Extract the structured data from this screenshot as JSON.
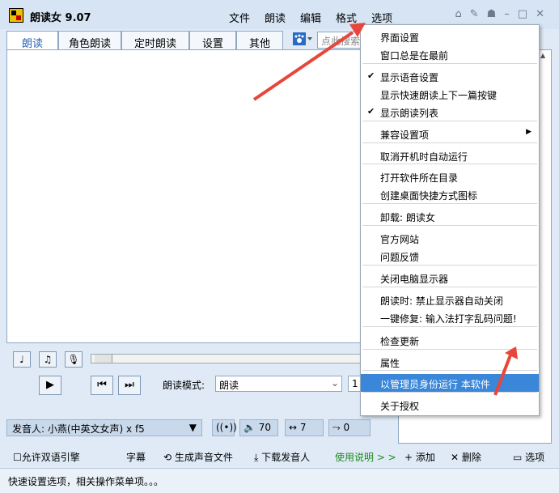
{
  "app": {
    "title": "朗读女 9.07"
  },
  "menubar": [
    "文件",
    "朗读",
    "编辑",
    "格式",
    "选项"
  ],
  "tabs": [
    "朗读",
    "角色朗读",
    "定时朗读",
    "设置",
    "其他"
  ],
  "search": {
    "placeholder": "点此搜索"
  },
  "controls": {
    "mode_label": "朗读模式:",
    "mode_value": "朗读",
    "small_value": "1"
  },
  "voice": {
    "speaker": "发音人: 小燕(中英文女声) x f5",
    "volume": "70",
    "speed": "7",
    "pitch": "0"
  },
  "bottom": {
    "bilingual": "允许双语引擎",
    "subtitles": "字幕",
    "generate_audio": "生成声音文件",
    "download_voice": "下载发音人",
    "help": "使用说明 > >",
    "add": "添加",
    "delete": "删除",
    "options": "选项"
  },
  "status": "快速设置选项，相关操作菜单项。。。",
  "dropdown": {
    "items": [
      {
        "label": "界面设置",
        "checked": false,
        "submenu": false
      },
      {
        "label": "窗口总是在最前",
        "checked": false,
        "submenu": false
      },
      {
        "label": "显示语音设置",
        "checked": true,
        "submenu": false
      },
      {
        "label": "显示快速朗读上下一篇按键",
        "checked": false,
        "submenu": false
      },
      {
        "label": "显示朗读列表",
        "checked": true,
        "submenu": false
      },
      {
        "label": "兼容设置项",
        "checked": false,
        "submenu": true
      },
      {
        "label": "取消开机时自动运行",
        "checked": false,
        "submenu": false
      },
      {
        "label": "打开软件所在目录",
        "checked": false,
        "submenu": false
      },
      {
        "label": "创建桌面快捷方式图标",
        "checked": false,
        "submenu": false
      },
      {
        "label": "卸载: 朗读女",
        "checked": false,
        "submenu": false
      },
      {
        "label": "官方网站",
        "checked": false,
        "submenu": false
      },
      {
        "label": "问题反馈",
        "checked": false,
        "submenu": false
      },
      {
        "label": "关闭电脑显示器",
        "checked": false,
        "submenu": false
      },
      {
        "label": "朗读时: 禁止显示器自动关闭",
        "checked": false,
        "submenu": false
      },
      {
        "label": "一键修复: 输入法打字乱码问题!",
        "checked": false,
        "submenu": false
      },
      {
        "label": "检查更新",
        "checked": false,
        "submenu": false
      },
      {
        "label": "属性",
        "checked": false,
        "submenu": false
      },
      {
        "label": "以管理员身份运行 本软件",
        "checked": false,
        "submenu": false,
        "selected": true
      },
      {
        "label": "关于授权",
        "checked": false,
        "submenu": false
      }
    ]
  },
  "colors": {
    "highlight": "#3a87d9",
    "arrow": "#e8463a",
    "title_bg": "#d6e4f3"
  }
}
